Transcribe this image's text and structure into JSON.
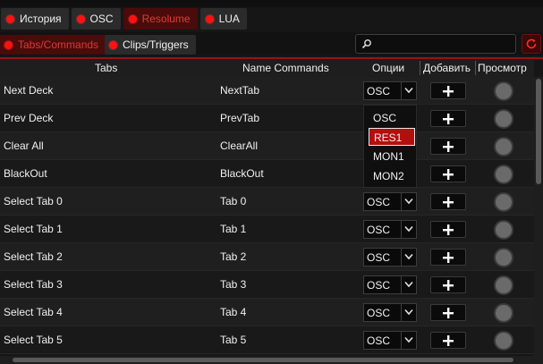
{
  "tabs": [
    {
      "label": "История",
      "active": false
    },
    {
      "label": "OSC",
      "active": false
    },
    {
      "label": "Resolume",
      "active": true
    },
    {
      "label": "LUA",
      "active": false
    }
  ],
  "subtabs": [
    {
      "label": "Tabs/Commands",
      "active": true
    },
    {
      "label": "Clips/Triggers",
      "active": false
    }
  ],
  "search": {
    "value": ""
  },
  "table": {
    "headers": {
      "tabs": "Tabs",
      "commands": "Name Commands",
      "options": "Опции",
      "add": "Добавить",
      "preview": "Просмотр"
    },
    "rows": [
      {
        "tab": "Next Deck",
        "command": "NextTab",
        "option": "OSC"
      },
      {
        "tab": "Prev Deck",
        "command": "PrevTab",
        "option": ""
      },
      {
        "tab": "Clear All",
        "command": "ClearAll",
        "option": ""
      },
      {
        "tab": "BlackOut",
        "command": "BlackOut",
        "option": ""
      },
      {
        "tab": "Select Tab 0",
        "command": "Tab 0",
        "option": "OSC"
      },
      {
        "tab": "Select Tab 1",
        "command": "Tab 1",
        "option": "OSC"
      },
      {
        "tab": "Select Tab 2",
        "command": "Tab 2",
        "option": "OSC"
      },
      {
        "tab": "Select Tab 3",
        "command": "Tab 3",
        "option": "OSC"
      },
      {
        "tab": "Select Tab 4",
        "command": "Tab 4",
        "option": "OSC"
      },
      {
        "tab": "Select Tab 5",
        "command": "Tab 5",
        "option": "OSC"
      }
    ]
  },
  "dropdown": {
    "options": [
      "OSC",
      "RES1",
      "MON1",
      "MON2"
    ],
    "selected": "RES1"
  },
  "colors": {
    "accent": "#ff1111",
    "active_tab_bg": "#4a0b0b",
    "selected_option": "#b40f0f"
  },
  "icons": {
    "search": "search-icon",
    "refresh": "refresh-icon",
    "add": "plus-icon",
    "dropdown": "chevron-down-icon",
    "status": "status-dot-icon",
    "preview": "preview-circle-icon"
  }
}
